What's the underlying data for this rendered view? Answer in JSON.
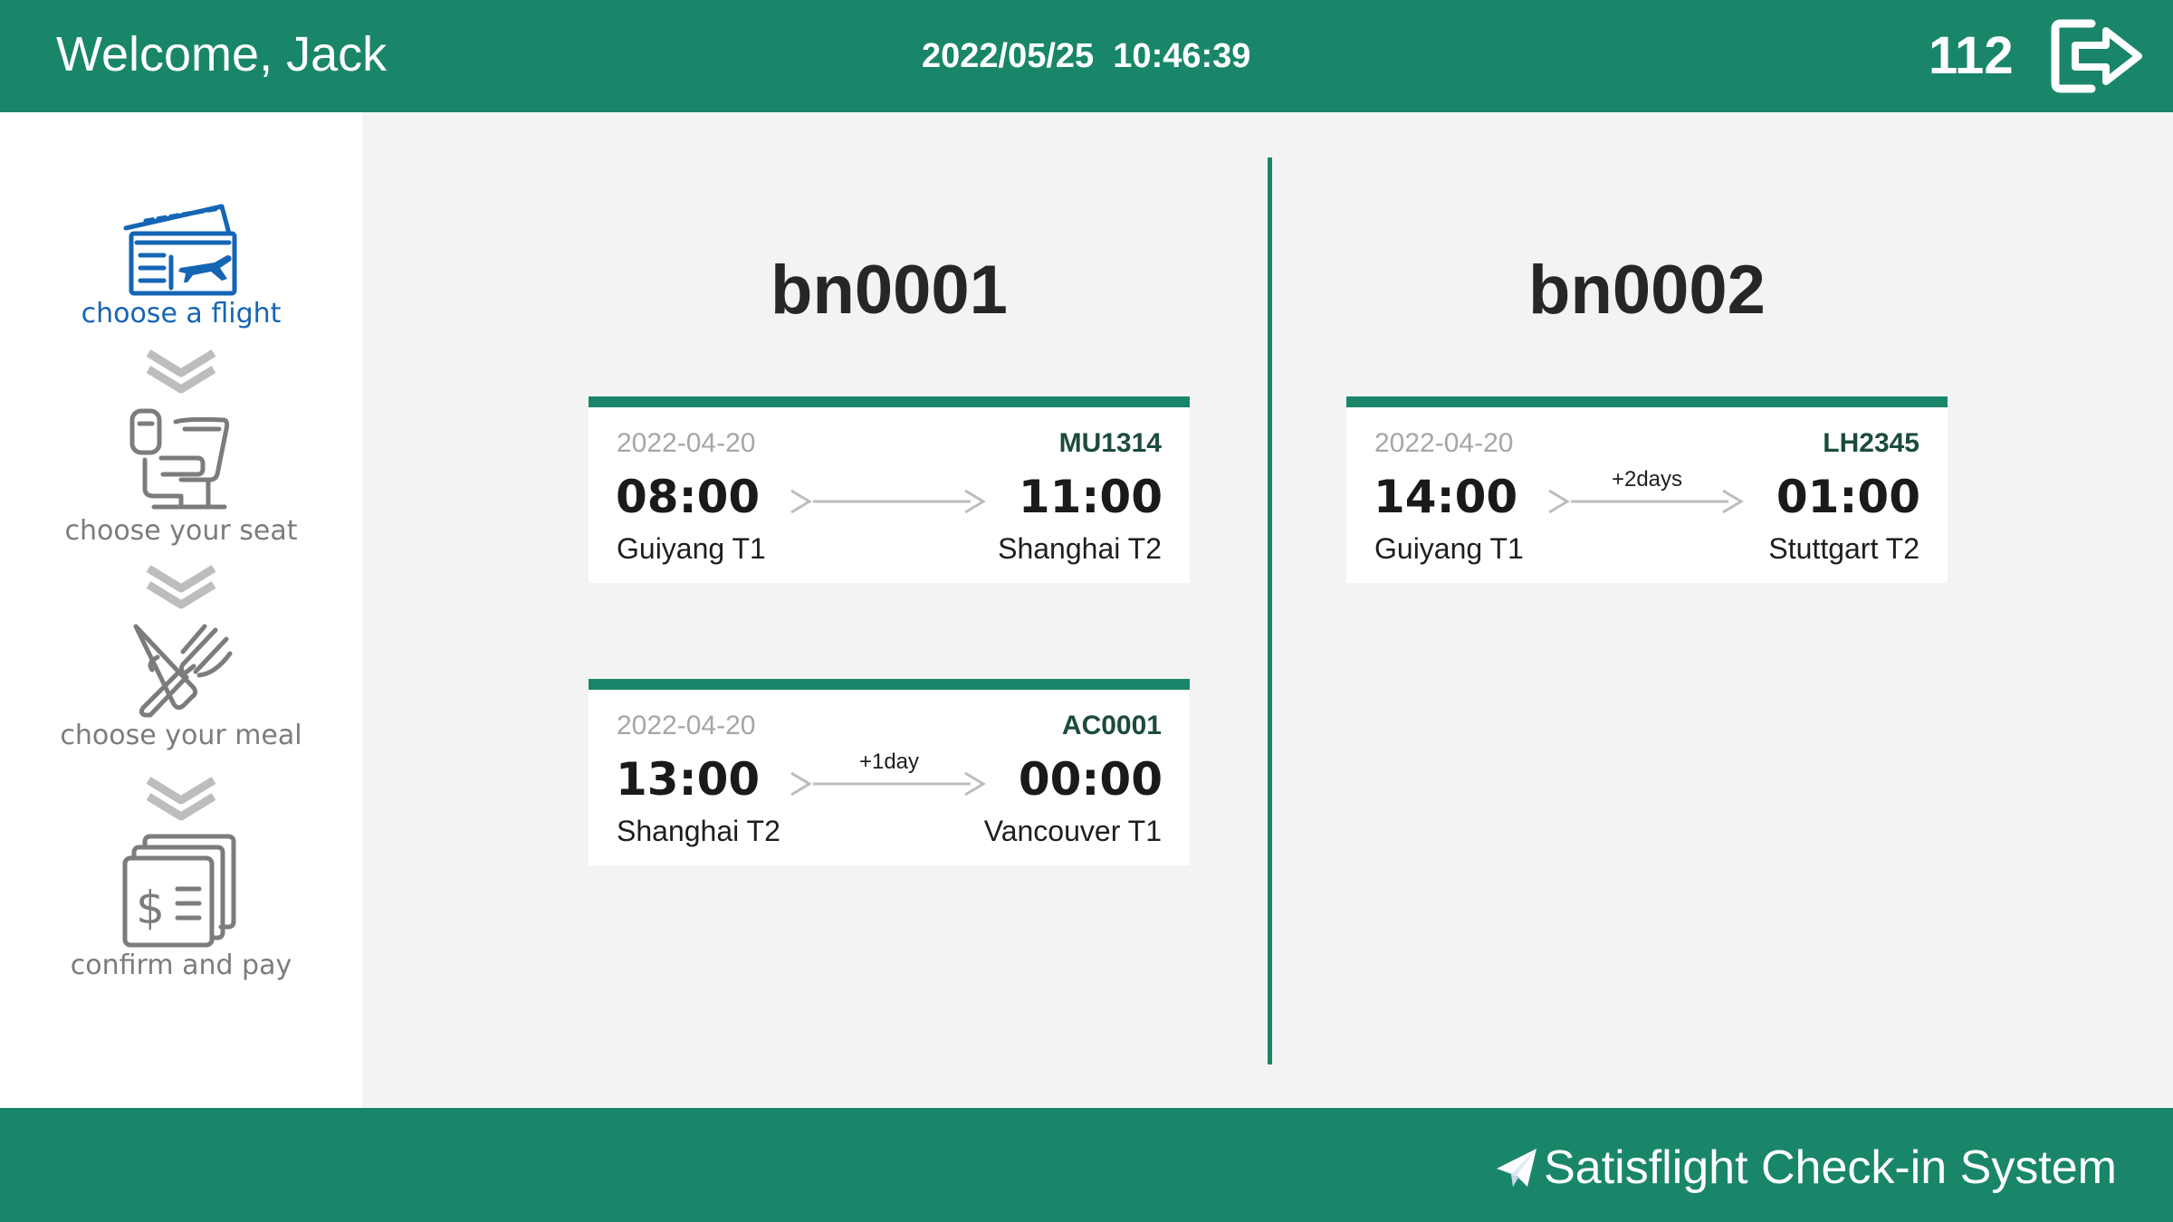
{
  "header": {
    "welcome": "Welcome, Jack",
    "datetime": "2022/05/25  10:46:39",
    "counter": "112",
    "logout_icon": "logout-arrow-icon"
  },
  "sidebar": {
    "steps": [
      {
        "label": "choose a flight",
        "icon": "boarding-pass-icon",
        "active": true
      },
      {
        "label": "choose your seat",
        "icon": "airplane-seat-icon",
        "active": false
      },
      {
        "label": "choose your meal",
        "icon": "fork-knife-icon",
        "active": false
      },
      {
        "label": "confirm and pay",
        "icon": "bill-payment-icon",
        "active": false
      }
    ]
  },
  "bookings": [
    {
      "id": "bn0001",
      "flights": [
        {
          "date": "2022-04-20",
          "flight_no": "MU1314",
          "dep_time": "08:00",
          "arr_time": "11:00",
          "dep_place": "Guiyang T1",
          "arr_place": "Shanghai T2",
          "day_offset": ""
        },
        {
          "date": "2022-04-20",
          "flight_no": "AC0001",
          "dep_time": "13:00",
          "arr_time": "00:00",
          "dep_place": "Shanghai T2",
          "arr_place": "Vancouver T1",
          "day_offset": "+1day"
        }
      ]
    },
    {
      "id": "bn0002",
      "flights": [
        {
          "date": "2022-04-20",
          "flight_no": "LH2345",
          "dep_time": "14:00",
          "arr_time": "01:00",
          "dep_place": "Guiyang T1",
          "arr_place": "Stuttgart T2",
          "day_offset": "+2days"
        }
      ]
    }
  ],
  "footer": {
    "brand": "Satisflight Check-in System",
    "brand_icon": "paper-plane-icon"
  },
  "colors": {
    "primary": "#198669",
    "active_step": "#1565b5",
    "inactive_step": "#7c7c7c",
    "flight_no": "#1c4b3e",
    "date": "#a6a6a6",
    "background": "#f3f3f3"
  }
}
